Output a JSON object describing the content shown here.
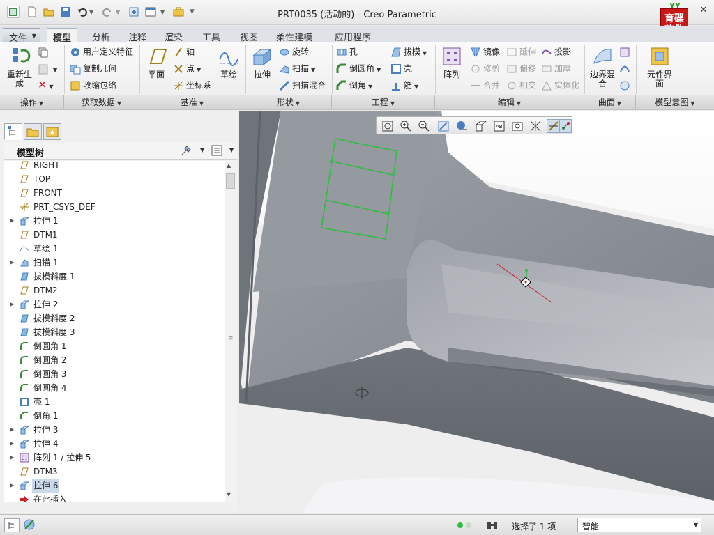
{
  "app": {
    "title": "PRT0035 (活动的) - Creo Parametric"
  },
  "logo": {
    "text_top": "育碟",
    "text_bottom": "软件",
    "leaf": "YY"
  },
  "window_controls": {
    "minimize": "–",
    "close": "✕"
  },
  "quick_access": [
    "new-icon",
    "open-icon",
    "save-icon",
    "undo-icon",
    "redo-icon",
    "regenerate-icon",
    "window-icon",
    "close-window-icon",
    "customize-icon"
  ],
  "tabs": [
    {
      "label": "文件",
      "active": false
    },
    {
      "label": "模型",
      "active": true
    },
    {
      "label": "分析",
      "active": false
    },
    {
      "label": "注释",
      "active": false
    },
    {
      "label": "渲染",
      "active": false
    },
    {
      "label": "工具",
      "active": false
    },
    {
      "label": "视图",
      "active": false
    },
    {
      "label": "柔性建模",
      "active": false
    },
    {
      "label": "应用程序",
      "active": false
    }
  ],
  "ribbon": {
    "operations": {
      "regenerate": "重新生成",
      "group": "操作"
    },
    "get_data": {
      "udf": "用户定义特征",
      "copy_geom": "复制几何",
      "shrinkwrap": "收缩包络",
      "group": "获取数据"
    },
    "datum": {
      "plane": "平面",
      "axis": "轴",
      "point": "点",
      "csys": "坐标系",
      "sketch": "草绘",
      "group": "基准"
    },
    "shapes": {
      "extrude": "拉伸",
      "revolve": "旋转",
      "sweep": "扫描",
      "swept_blend": "扫描混合",
      "group": "形状"
    },
    "engineering": {
      "hole": "孔",
      "round": "倒圆角",
      "chamfer": "倒角",
      "draft": "拔模",
      "shell": "壳",
      "rib": "筋",
      "group": "工程"
    },
    "editing": {
      "pattern": "阵列",
      "mirror": "镜像",
      "trim": "修剪",
      "merge": "合并",
      "extend": "延伸",
      "offset": "偏移",
      "intersect": "相交",
      "project": "投影",
      "thicken": "加厚",
      "solidify": "实体化",
      "group": "编辑"
    },
    "surfaces": {
      "boundary_blend": "边界混合",
      "group": "曲面"
    },
    "model_intent": {
      "component_interface": "元件界面",
      "group": "模型意图"
    }
  },
  "model_tree": {
    "title": "模型树",
    "items": [
      {
        "label": "RIGHT",
        "icon": "datum-plane-icon",
        "expandable": false
      },
      {
        "label": "TOP",
        "icon": "datum-plane-icon",
        "expandable": false
      },
      {
        "label": "FRONT",
        "icon": "datum-plane-icon",
        "expandable": false
      },
      {
        "label": "PRT_CSYS_DEF",
        "icon": "csys-icon",
        "expandable": false
      },
      {
        "label": "拉伸 1",
        "icon": "extrude-icon",
        "expandable": true
      },
      {
        "label": "DTM1",
        "icon": "datum-plane-icon",
        "expandable": false
      },
      {
        "label": "草绘 1",
        "icon": "sketch-icon",
        "expandable": false
      },
      {
        "label": "扫描 1",
        "icon": "sweep-icon",
        "expandable": true
      },
      {
        "label": "拔模斜度 1",
        "icon": "draft-icon",
        "expandable": false
      },
      {
        "label": "DTM2",
        "icon": "datum-plane-icon",
        "expandable": false
      },
      {
        "label": "拉伸 2",
        "icon": "extrude-icon",
        "expandable": true
      },
      {
        "label": "拔模斜度 2",
        "icon": "draft-icon",
        "expandable": false
      },
      {
        "label": "拔模斜度 3",
        "icon": "draft-icon",
        "expandable": false
      },
      {
        "label": "倒圆角 1",
        "icon": "round-icon",
        "expandable": false
      },
      {
        "label": "倒圆角 2",
        "icon": "round-icon",
        "expandable": false
      },
      {
        "label": "倒圆角 3",
        "icon": "round-icon",
        "expandable": false
      },
      {
        "label": "倒圆角 4",
        "icon": "round-icon",
        "expandable": false
      },
      {
        "label": "壳 1",
        "icon": "shell-icon",
        "expandable": false
      },
      {
        "label": "倒角 1",
        "icon": "chamfer-icon",
        "expandable": false
      },
      {
        "label": "拉伸 3",
        "icon": "extrude-icon",
        "expandable": true
      },
      {
        "label": "拉伸 4",
        "icon": "extrude-icon",
        "expandable": true
      },
      {
        "label": "阵列 1 / 拉伸 5",
        "icon": "pattern-icon",
        "expandable": true
      },
      {
        "label": "DTM3",
        "icon": "datum-plane-icon",
        "expandable": false
      },
      {
        "label": "拉伸 6",
        "icon": "extrude-icon",
        "expandable": true,
        "selected": true
      },
      {
        "label": "在此插入",
        "icon": "insert-here-icon",
        "expandable": false
      }
    ]
  },
  "status": {
    "selection": "选择了 1 项",
    "filter": "智能"
  },
  "colors": {
    "accent": "#4a7fbf",
    "sketch_green": "#2bbf3a",
    "axis_red": "#d11f2a",
    "model_gray": "#8a8e95"
  }
}
